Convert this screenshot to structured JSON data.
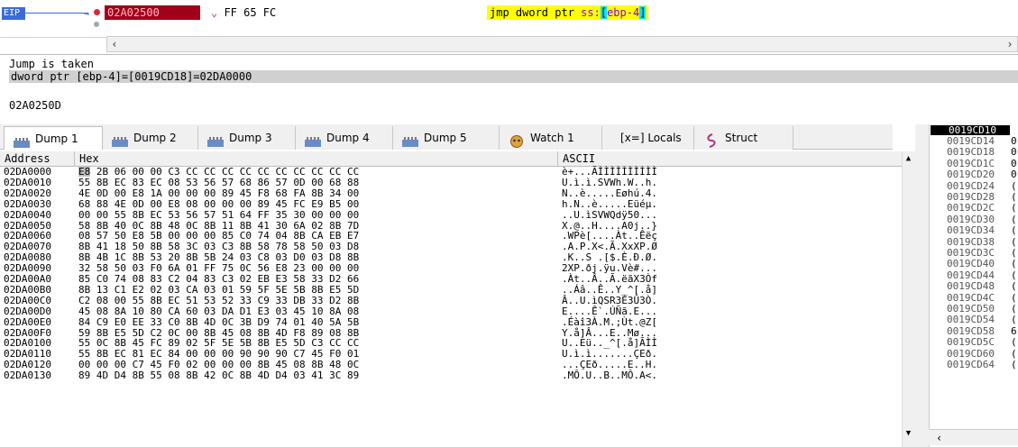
{
  "disasm": {
    "eip_label": "EIP",
    "addr_current": "02A02500",
    "bytes": "FF 65 FC",
    "instruction": {
      "mnemonic": "jmp dword ptr ",
      "seg": "ss:",
      "open": "[",
      "operand": "ebp-4",
      "close": "]"
    }
  },
  "info": {
    "line1": "Jump is taken",
    "line2": "dword ptr [ebp-4]=[0019CD18]=02DA0000",
    "address": "02A0250D"
  },
  "tabs": [
    {
      "label": "Dump 1"
    },
    {
      "label": "Dump 2"
    },
    {
      "label": "Dump 3"
    },
    {
      "label": "Dump 4"
    },
    {
      "label": "Dump 5"
    },
    {
      "label": "Watch 1"
    },
    {
      "label": "[x=] Locals"
    },
    {
      "label": "Struct"
    }
  ],
  "dump": {
    "headers": [
      "Address",
      "Hex",
      "ASCII"
    ],
    "rows": [
      {
        "a": "02DA0000",
        "h": "E8 2B 06 00 00 C3 CC CC CC CC CC CC CC CC CC CC",
        "s": "è+...ÃÌÌÌÌÌÌÌÌÌÌ"
      },
      {
        "a": "02DA0010",
        "h": "55 8B EC 83 EC 08 53 56 57 68 86 57 0D 00 68 88",
        "s": "U.ì.ì.SVWh.W..h."
      },
      {
        "a": "02DA0020",
        "h": "4E 0D 00 E8 1A 00 00 00 89 45 F8 68 FA 8B 34 00",
        "s": "N..è.....Eøhú.4."
      },
      {
        "a": "02DA0030",
        "h": "68 88 4E 0D 00 E8 08 00 00 00 89 45 FC E9 B5 00",
        "s": "h.N..è.....Eüéµ."
      },
      {
        "a": "02DA0040",
        "h": "00 00 55 8B EC 53 56 57 51 64 FF 35 30 00 00 00",
        "s": "..U.ìSVWQdÿ50..."
      },
      {
        "a": "02DA0050",
        "h": "58 8B 40 0C 8B 48 0C 8B 11 8B 41 30 6A 02 8B 7D",
        "s": "X.@..H....A0j..}"
      },
      {
        "a": "02DA0060",
        "h": "08 57 50 E8 5B 00 00 00 85 C0 74 04 8B CA EB E7",
        "s": ".WPè[....Àt..Êëç"
      },
      {
        "a": "02DA0070",
        "h": "8B 41 18 50 8B 58 3C 03 C3 8B 58 78 58 50 03 D8",
        "s": ".A.P.X<.Ã.XxXP.Ø"
      },
      {
        "a": "02DA0080",
        "h": "8B 4B 1C 8B 53 20 8B 5B 24 03 C8 03 D0 03 D8 8B",
        "s": ".K..S .[$.È.Ð.Ø."
      },
      {
        "a": "02DA0090",
        "h": "32 58 50 03 F0 6A 01 FF 75 0C 56 E8 23 00 00 00",
        "s": "2XP.ðj.ÿu.Vè#..."
      },
      {
        "a": "02DA00A0",
        "h": "85 C0 74 08 83 C2 04 83 C3 02 EB E3 58 33 D2 66",
        "s": ".Àt..Â..Ã.ëãX3Òf"
      },
      {
        "a": "02DA00B0",
        "h": "8B 13 C1 E2 02 03 CA 03 01 59 5F 5E 5B 8B E5 5D",
        "s": "..Áâ..Ê..Y_^[.å]"
      },
      {
        "a": "02DA00C0",
        "h": "C2 08 00 55 8B EC 51 53 52 33 C9 33 DB 33 D2 8B",
        "s": "Â..U.ìQSR3É3Û3Ò."
      },
      {
        "a": "02DA00D0",
        "h": "45 08 8A 10 80 CA 60 03 DA D1 E3 03 45 10 8A 08",
        "s": "E....Ê`.ÚÑã.E..."
      },
      {
        "a": "02DA00E0",
        "h": "84 C9 E0 EE 33 C0 8B 4D 0C 3B D9 74 01 40 5A 5B",
        "s": ".Éàî3À.M.;Ùt.@Z["
      },
      {
        "a": "02DA00F0",
        "h": "59 8B E5 5D C2 0C 00 8B 45 08 8B 4D F8 89 08 8B",
        "s": "Y.å]Â...E..Mø..."
      },
      {
        "a": "02DA0100",
        "h": "55 0C 8B 45 FC 89 02 5F 5E 5B 8B E5 5D C3 CC CC",
        "s": "U..Eü.._^[.å]ÃÌÌ"
      },
      {
        "a": "02DA0110",
        "h": "55 8B EC 81 EC 84 00 00 00 90 90 90 C7 45 F0 01",
        "s": "U.ì.ì.......ÇEð."
      },
      {
        "a": "02DA0120",
        "h": "00 00 00 C7 45 F0 02 00 00 00 8B 45 08 8B 48 0C",
        "s": "...ÇEð.....E..H."
      },
      {
        "a": "02DA0130",
        "h": "89 4D D4 8B 55 08 8B 42 0C 8B 4D D4 03 41 3C 89",
        "s": ".MÔ.U..B..MÔ.A<."
      }
    ]
  },
  "stack": {
    "current": "0019CD10",
    "rows": [
      "0019CD14",
      "0019CD18",
      "0019CD1C",
      "0019CD20",
      "0019CD24",
      "0019CD28",
      "0019CD2C",
      "0019CD30",
      "0019CD34",
      "0019CD38",
      "0019CD3C",
      "0019CD40",
      "0019CD44",
      "0019CD48",
      "0019CD4C",
      "0019CD50",
      "0019CD54",
      "0019CD58",
      "0019CD5C",
      "0019CD60",
      "0019CD64"
    ],
    "values": [
      "0",
      "0",
      "0",
      "0",
      "(",
      "(",
      "(",
      "(",
      "(",
      "(",
      "(",
      "(",
      "(",
      "(",
      "(",
      "(",
      "(",
      "6",
      "(",
      "(",
      "("
    ]
  },
  "colors": {
    "eip": "#3a6cd8",
    "addr_bg": "#a1001b",
    "highlight": "#ffff00",
    "reg": "#8000ff",
    "bracket": "#00e1ff"
  }
}
